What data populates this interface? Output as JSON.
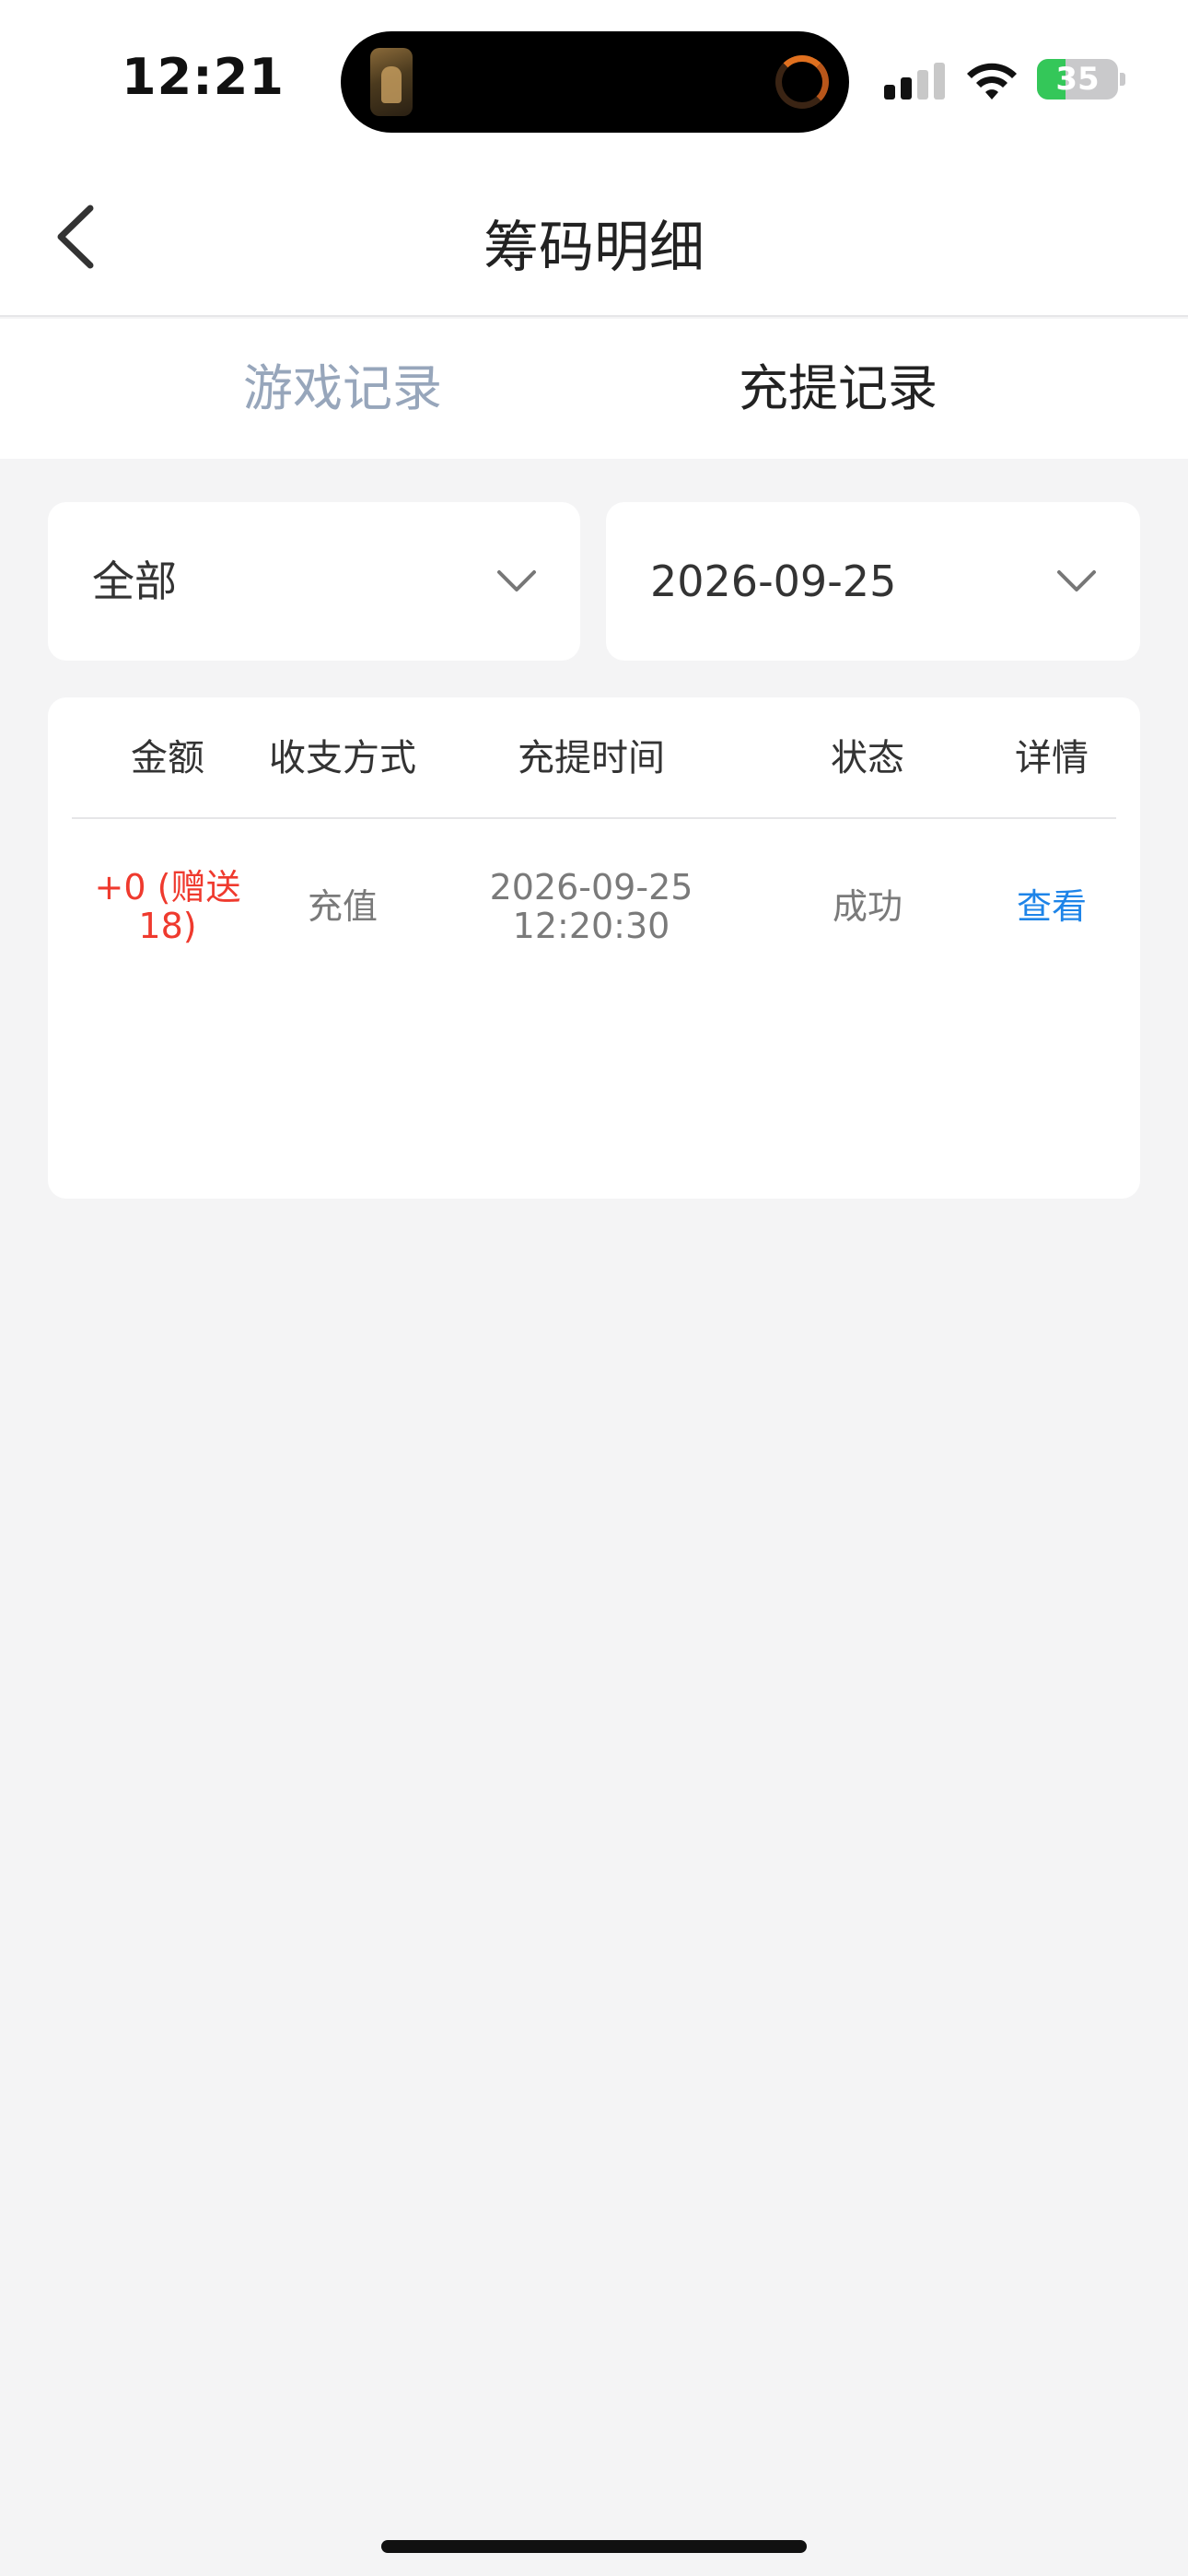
{
  "status_bar": {
    "time": "12:21",
    "battery_percent": "35",
    "battery_level": 0.35,
    "signal_bars": 2,
    "icons": [
      "signal-icon",
      "wifi-icon",
      "battery-charging-icon"
    ]
  },
  "nav": {
    "title": "筹码明细",
    "back_icon": "chevron-left-icon"
  },
  "tabs": [
    {
      "label": "游戏记录",
      "active": false
    },
    {
      "label": "充提记录",
      "active": true
    }
  ],
  "filters": {
    "type_value": "全部",
    "date_value": "2026-09-25",
    "chevron_icon": "chevron-down-icon"
  },
  "table": {
    "headers": [
      "金额",
      "收支方式",
      "充提时间",
      "状态",
      "详情"
    ],
    "rows": [
      {
        "amount_line1": "+0 (赠送",
        "amount_line2": "18)",
        "method": "充值",
        "date": "2026-09-25",
        "time": "12:20:30",
        "status": "成功",
        "detail": "查看"
      }
    ]
  },
  "colors": {
    "amount": "#ef3a2e",
    "link": "#1e84e8",
    "inactive_tab": "#97a6bb",
    "background": "#f4f4f5"
  }
}
